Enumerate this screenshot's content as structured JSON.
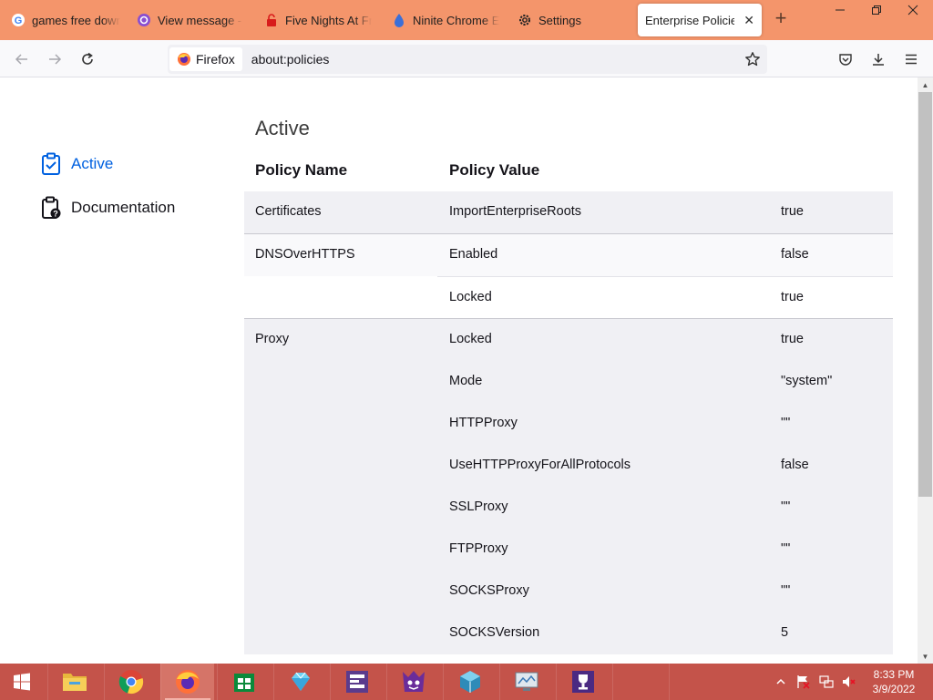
{
  "tabs": [
    {
      "title": "games free downl",
      "icon": "google-icon"
    },
    {
      "title": "View message - M",
      "icon": "mail-icon"
    },
    {
      "title": "Five Nights At Fre",
      "icon": "lock-icon"
    },
    {
      "title": "Ninite Chrome Ed",
      "icon": "ninite-icon"
    },
    {
      "title": "Settings",
      "icon": "gear-icon"
    },
    {
      "title": "Enterprise Policies",
      "icon": "none",
      "active": true
    }
  ],
  "nav": {
    "identity_label": "Firefox",
    "url": "about:policies"
  },
  "sidebar": {
    "items": [
      {
        "label": "Active",
        "icon": "clipboard-check-icon",
        "selected": true
      },
      {
        "label": "Documentation",
        "icon": "clipboard-help-icon",
        "selected": false
      }
    ]
  },
  "main": {
    "heading": "Active",
    "col_name": "Policy Name",
    "col_value": "Policy Value"
  },
  "policies": [
    {
      "name": "Certificates",
      "rows": [
        {
          "key": "ImportEnterpriseRoots",
          "value": "true"
        }
      ]
    },
    {
      "name": "DNSOverHTTPS",
      "rows": [
        {
          "key": "Enabled",
          "value": "false"
        },
        {
          "key": "Locked",
          "value": "true"
        }
      ]
    },
    {
      "name": "Proxy",
      "rows": [
        {
          "key": "Locked",
          "value": "true"
        },
        {
          "key": "Mode",
          "value": "\"system\""
        },
        {
          "key": "HTTPProxy",
          "value": "\"\""
        },
        {
          "key": "UseHTTPProxyForAllProtocols",
          "value": "false"
        },
        {
          "key": "SSLProxy",
          "value": "\"\""
        },
        {
          "key": "FTPProxy",
          "value": "\"\""
        },
        {
          "key": "SOCKSProxy",
          "value": "\"\""
        },
        {
          "key": "SOCKSVersion",
          "value": "5"
        }
      ]
    }
  ],
  "taskbar": {
    "apps": [
      "file-explorer-icon",
      "chrome-icon",
      "firefox-icon",
      "store-icon",
      "gem-app-icon",
      "editor-app-icon",
      "game-app-icon",
      "cube-app-icon",
      "monitor-app-icon",
      "trophy-app-icon"
    ],
    "time": "8:33 PM",
    "date": "3/9/2022"
  },
  "colors": {
    "tabstrip": "#f4956b",
    "taskbar": "#c4534a",
    "accent": "#0061e0"
  }
}
